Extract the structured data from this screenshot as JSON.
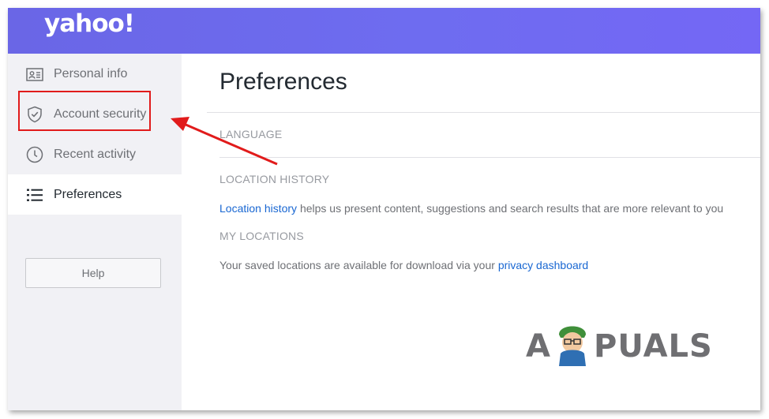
{
  "brand": {
    "logo_text": "yahoo!"
  },
  "sidebar": {
    "items": [
      {
        "label": "Personal info",
        "icon": "id-card-icon",
        "active": false
      },
      {
        "label": "Account security",
        "icon": "shield-check-icon",
        "active": false
      },
      {
        "label": "Recent activity",
        "icon": "clock-icon",
        "active": false
      },
      {
        "label": "Preferences",
        "icon": "list-icon",
        "active": true
      }
    ],
    "help_label": "Help"
  },
  "main": {
    "title": "Preferences",
    "sections": {
      "language": {
        "label": "LANGUAGE"
      },
      "location_history": {
        "label": "LOCATION HISTORY",
        "link_text": "Location history",
        "text": " helps us present content, suggestions and search results that are more relevant to you"
      },
      "my_locations": {
        "label": "MY LOCATIONS",
        "text": "Your saved locations are available for download via your ",
        "link_text": "privacy dashboard"
      }
    }
  },
  "annotation": {
    "color": "#e11b1b"
  },
  "watermark": {
    "text_left": "A",
    "text_right": "PUALS"
  },
  "colors": {
    "header_start": "#6a66e6",
    "header_end": "#7467f5",
    "sidebar_bg": "#f1f1f5",
    "link": "#1967d2"
  }
}
